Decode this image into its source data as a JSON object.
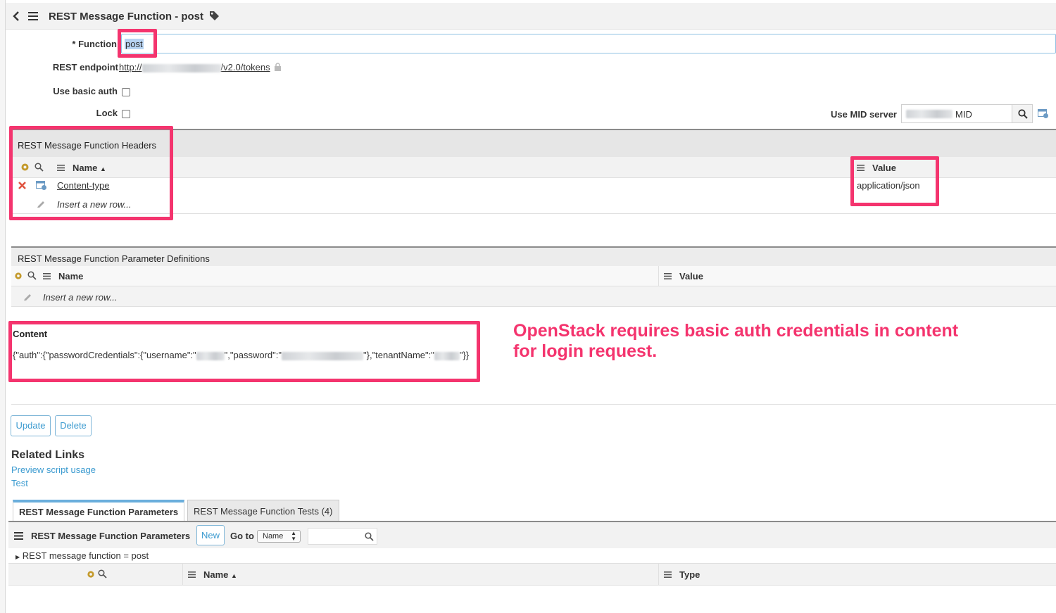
{
  "header": {
    "title": "REST Message Function - post"
  },
  "form": {
    "function_label": "Function",
    "function_required_mark": "*",
    "function_value": "post",
    "endpoint_label": "REST endpoint",
    "endpoint_prefix": "http://",
    "endpoint_suffix": "/v2.0/tokens",
    "basic_auth_label": "Use basic auth",
    "lock_label": "Lock",
    "mid_label": "Use MID server",
    "mid_value_suffix": "MID"
  },
  "headers_section": {
    "title": "REST Message Function Headers",
    "col_name": "Name",
    "col_value": "Value",
    "rows": [
      {
        "name": "Content-type",
        "value": "application/json"
      }
    ],
    "insert_row": "Insert a new row..."
  },
  "params_section": {
    "title": "REST Message Function Parameter Definitions",
    "col_name": "Name",
    "col_value": "Value",
    "insert_row": "Insert a new row..."
  },
  "content_section": {
    "label": "Content",
    "part1": "{\"auth\":{\"passwordCredentials\":{\"username\":\"",
    "part2": "\",\"password\":\"",
    "part3": "\"},\"tenantName\":\"",
    "part4": "\"}}"
  },
  "annotation": {
    "line1": "OpenStack requires basic auth credentials in content",
    "line2": "for login request."
  },
  "buttons": {
    "update": "Update",
    "delete": "Delete"
  },
  "related_links": {
    "title": "Related Links",
    "links": [
      "Preview script usage",
      "Test"
    ]
  },
  "tabs": [
    {
      "label": "REST Message Function Parameters",
      "active": true
    },
    {
      "label": "REST Message Function Tests (4)",
      "active": false
    }
  ],
  "related_list": {
    "title": "REST Message Function Parameters",
    "new_button": "New",
    "goto_label": "Go to",
    "goto_select": "Name",
    "breadcrumb": "REST message function = post",
    "col_name": "Name",
    "col_type": "Type"
  },
  "colors": {
    "highlight": "#f4346e",
    "link": "#3c9bd0",
    "header_bg": "#f2f2f2"
  }
}
